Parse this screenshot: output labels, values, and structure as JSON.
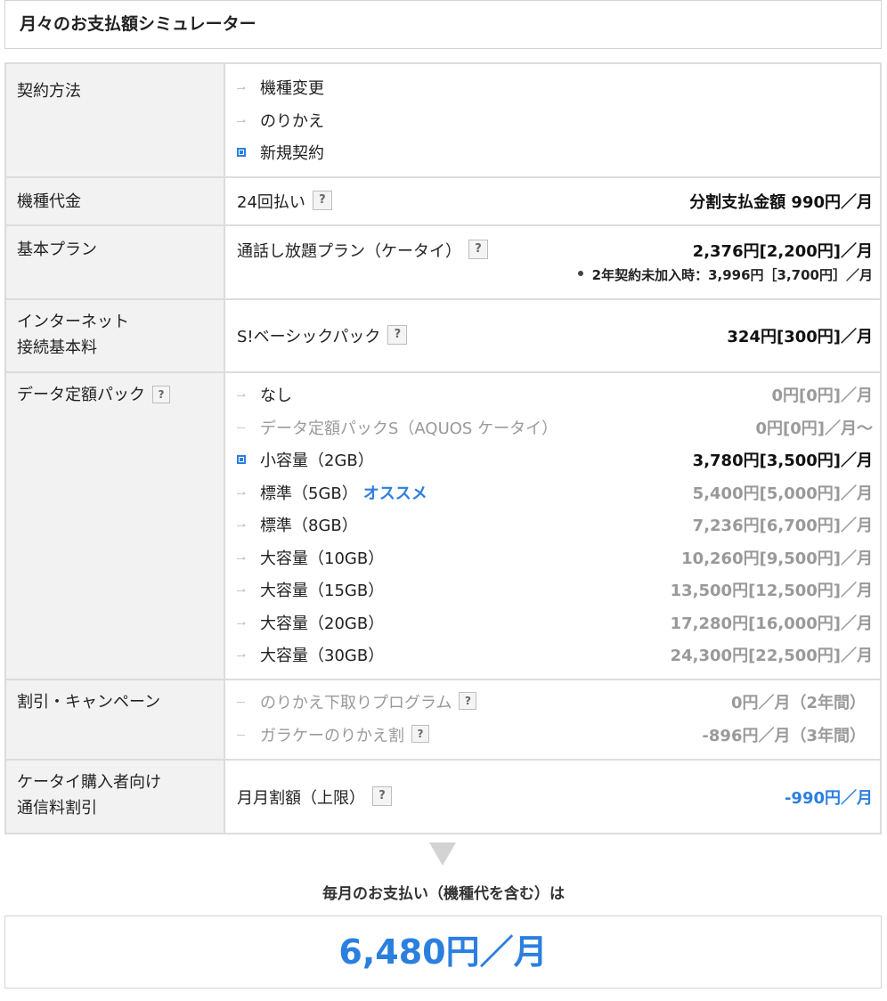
{
  "title": "月々のお支払額シミュレーター",
  "rows": {
    "contract": {
      "label": "契約方法",
      "options": [
        {
          "label": "機種変更",
          "selected": false
        },
        {
          "label": "のりかえ",
          "selected": false
        },
        {
          "label": "新規契約",
          "selected": true
        }
      ]
    },
    "device": {
      "label": "機種代金",
      "payment": "24回払い",
      "price": "分割支払金額 990円／月"
    },
    "plan": {
      "label": "基本プラン",
      "name": "通話し放題プラン（ケータイ）",
      "price": "2,376円[2,200円]／月",
      "note": "2年契約未加入時：3,996円［3,700円］／月"
    },
    "internet": {
      "label_line1": "インターネット",
      "label_line2": "接続基本料",
      "name": "S!ベーシックパック",
      "price": "324円[300円]／月"
    },
    "data_pack": {
      "label": "データ定額パック",
      "recommend_label": "オススメ",
      "options": [
        {
          "label": "なし",
          "price": "0円[0円]／月",
          "selected": false,
          "muted": false
        },
        {
          "label": "データ定額パックS（AQUOS ケータイ）",
          "price": "0円[0円]／月〜",
          "selected": false,
          "muted": true
        },
        {
          "label": "小容量（2GB）",
          "price": "3,780円[3,500円]／月",
          "selected": true,
          "muted": false
        },
        {
          "label": "標準（5GB）",
          "price": "5,400円[5,000円]／月",
          "selected": false,
          "muted": false
        },
        {
          "label": "標準（8GB）",
          "price": "7,236円[6,700円]／月",
          "selected": false,
          "muted": false
        },
        {
          "label": "大容量（10GB）",
          "price": "10,260円[9,500円]／月",
          "selected": false,
          "muted": false
        },
        {
          "label": "大容量（15GB）",
          "price": "13,500円[12,500円]／月",
          "selected": false,
          "muted": false
        },
        {
          "label": "大容量（20GB）",
          "price": "17,280円[16,000円]／月",
          "selected": false,
          "muted": false
        },
        {
          "label": "大容量（30GB）",
          "price": "24,300円[22,500円]／月",
          "selected": false,
          "muted": false
        }
      ]
    },
    "discount": {
      "label": "割引・キャンペーン",
      "options": [
        {
          "label": "のりかえ下取りプログラム",
          "price": "0円／月（2年間）"
        },
        {
          "label": "ガラケーのりかえ割",
          "price": "-896円／月（3年間）"
        }
      ]
    },
    "buyer_discount": {
      "label_line1": "ケータイ購入者向け",
      "label_line2": "通信料割引",
      "name": "月月割額（上限）",
      "price": "-990円／月"
    }
  },
  "help_glyph": "?",
  "total": {
    "caption": "毎月のお支払い（機種代を含む）は",
    "amount": "6,480円／月"
  },
  "colors": {
    "accent": "#2b7fdf",
    "label_bg": "#f2f2f2",
    "border": "#dcdcdc"
  }
}
